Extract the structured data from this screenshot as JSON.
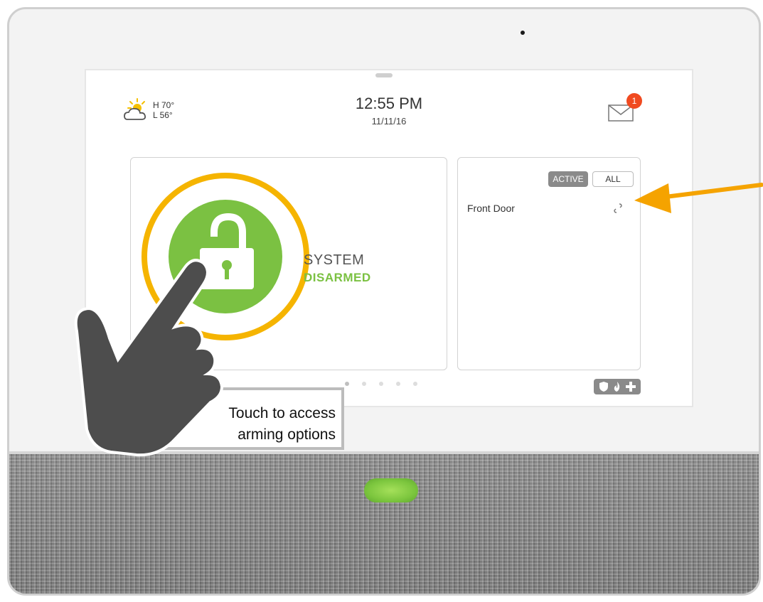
{
  "weather": {
    "icon": "partly-cloudy-icon",
    "high": "H 70°",
    "low": "L 56°"
  },
  "clock": {
    "time": "12:55 PM",
    "date": "11/11/16"
  },
  "messages": {
    "icon": "mail-icon",
    "badge_count": "1"
  },
  "security": {
    "label": "SYSTEM",
    "status": "DISARMED",
    "status_color": "#7bc142",
    "ring_color": "#f5b400"
  },
  "sensors": {
    "tabs": [
      {
        "label": "ACTIVE",
        "selected": true
      },
      {
        "label": "ALL",
        "selected": false
      }
    ],
    "items": [
      {
        "name": "Front Door",
        "icon": "open-link-icon"
      }
    ]
  },
  "pager": {
    "count": 5,
    "active_index": 0
  },
  "emergency": {
    "icons": [
      "shield-icon",
      "fire-icon",
      "cross-icon"
    ]
  },
  "callout": {
    "line1": "Touch to access",
    "line2": "arming options"
  },
  "annotation": {
    "arrow_color": "#f5a300",
    "hand_color": "#4d4d4d"
  }
}
